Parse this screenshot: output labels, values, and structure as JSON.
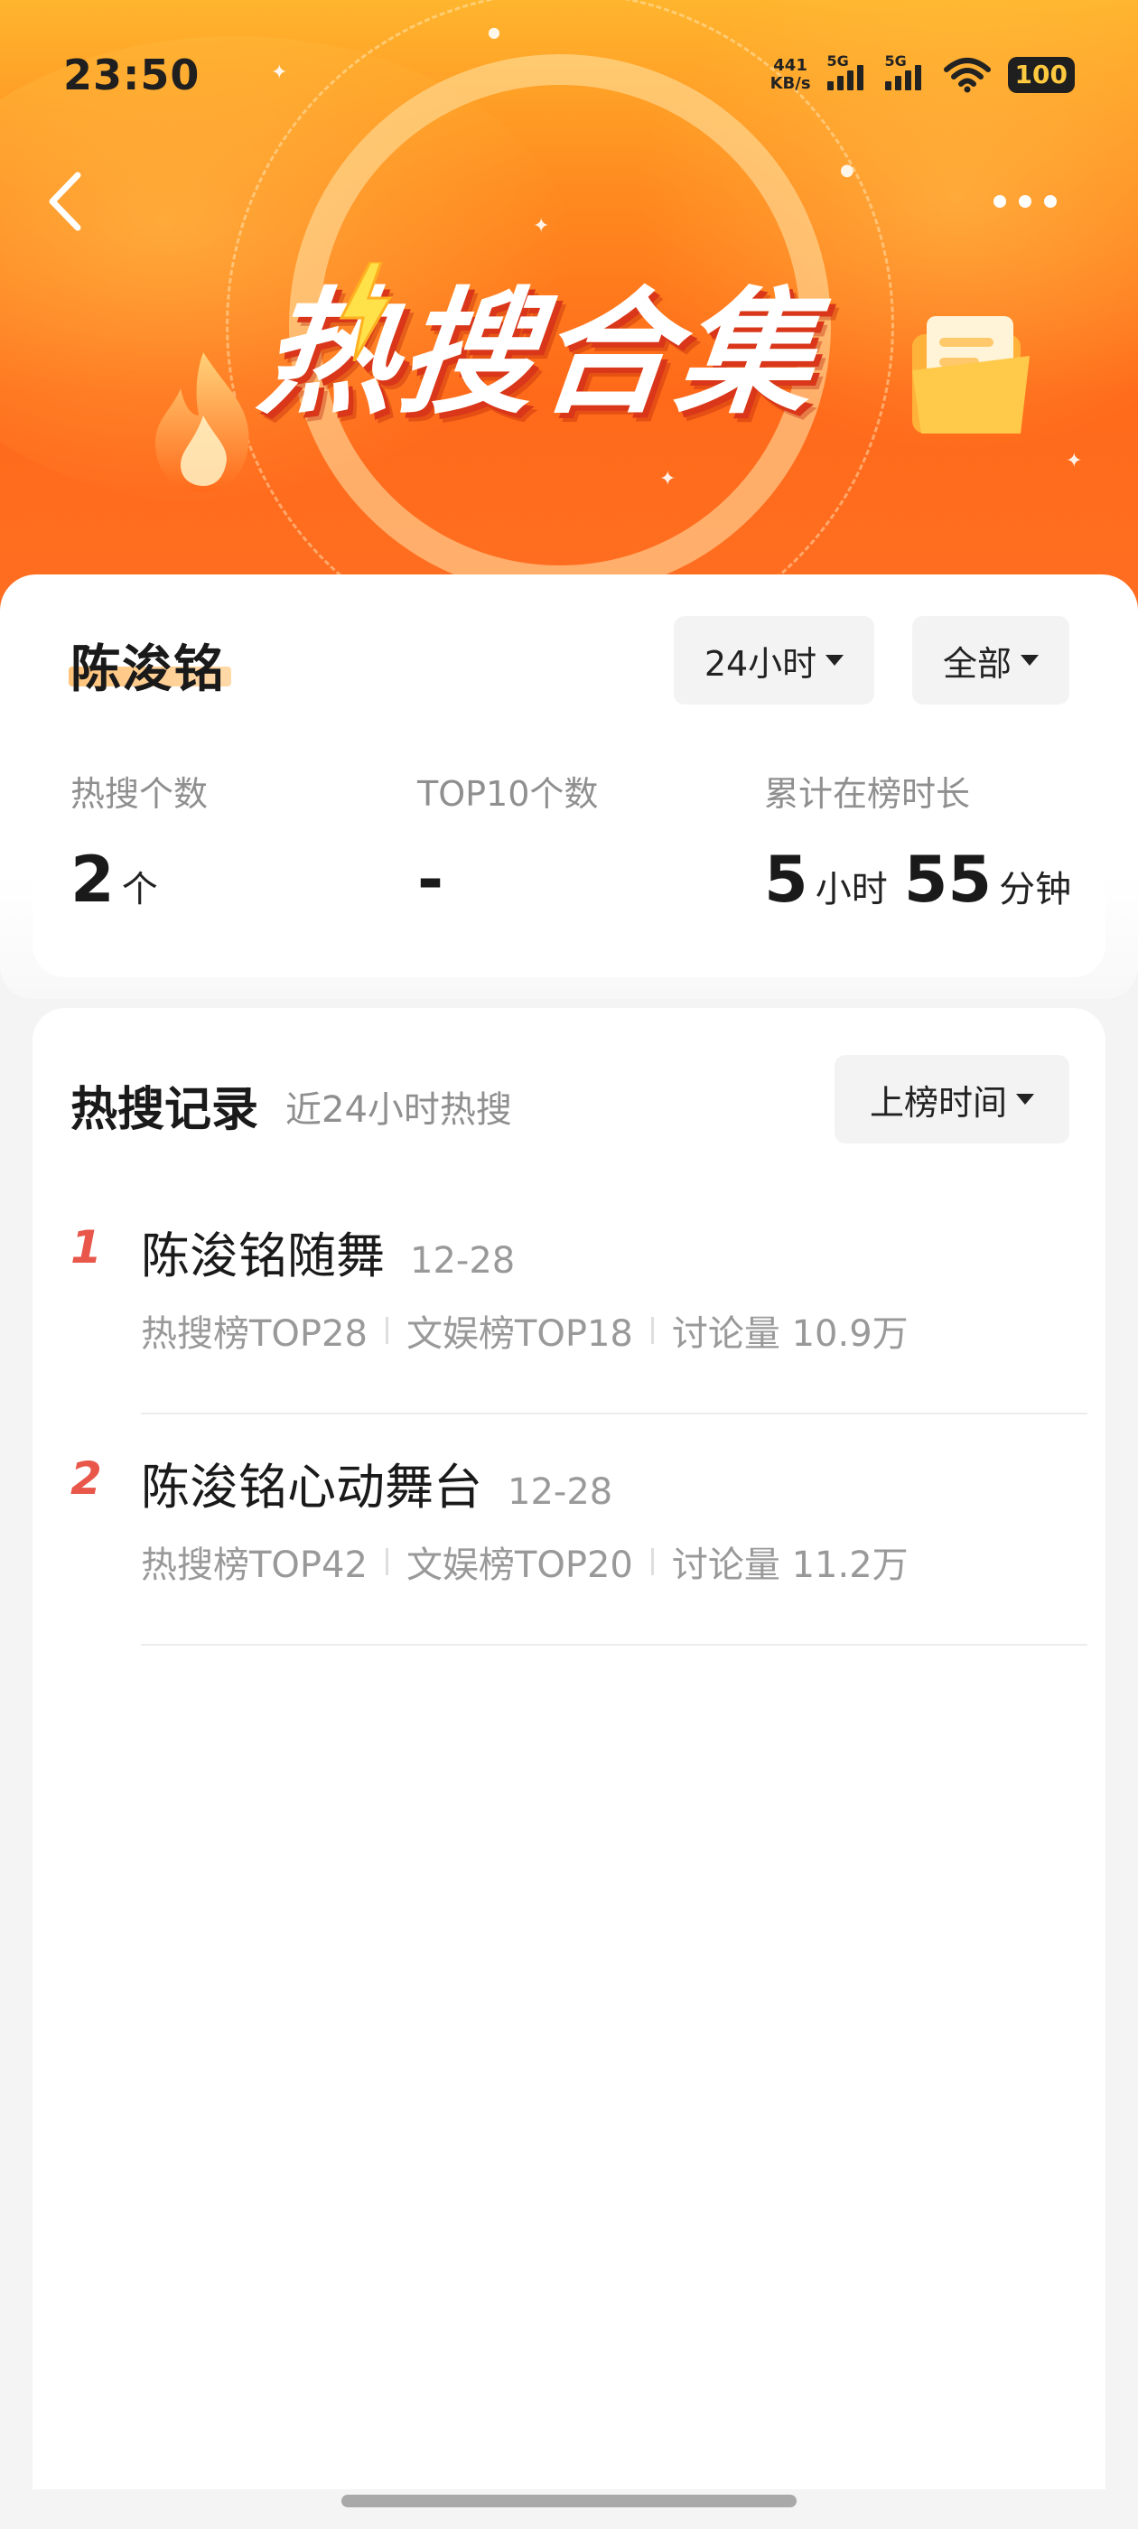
{
  "status_bar": {
    "time": "23:50",
    "net_speed_value": "441",
    "net_speed_unit": "KB/s",
    "signal1_label": "5G",
    "signal2_label": "5G",
    "battery": "100"
  },
  "hero": {
    "title": "热搜合集",
    "colors": {
      "top": "#ffb52e",
      "bottom": "#ff6a1a"
    }
  },
  "summary": {
    "name": "陈浚铭",
    "time_filter": "24小时",
    "scope_filter": "全部",
    "stats": {
      "count_label": "热搜个数",
      "count_value": "2",
      "count_unit": "个",
      "top10_label": "TOP10个数",
      "top10_value": "-",
      "duration_label": "累计在榜时长",
      "duration_hours": "5",
      "duration_hours_unit": "小时",
      "duration_minutes": "55",
      "duration_minutes_unit": "分钟"
    }
  },
  "records": {
    "title": "热搜记录",
    "subtitle": "近24小时热搜",
    "sort_label": "上榜时间",
    "items": [
      {
        "rank": "1",
        "name": "陈浚铭随舞",
        "date": "12-28",
        "hot_rank": "热搜榜TOP28",
        "ent_rank": "文娱榜TOP18",
        "discussion": "讨论量 10.9万"
      },
      {
        "rank": "2",
        "name": "陈浚铭心动舞台",
        "date": "12-28",
        "hot_rank": "热搜榜TOP42",
        "ent_rank": "文娱榜TOP20",
        "discussion": "讨论量 11.2万"
      }
    ]
  },
  "accent_colors": {
    "rank": "#e8574a",
    "muted_text": "#999999"
  }
}
